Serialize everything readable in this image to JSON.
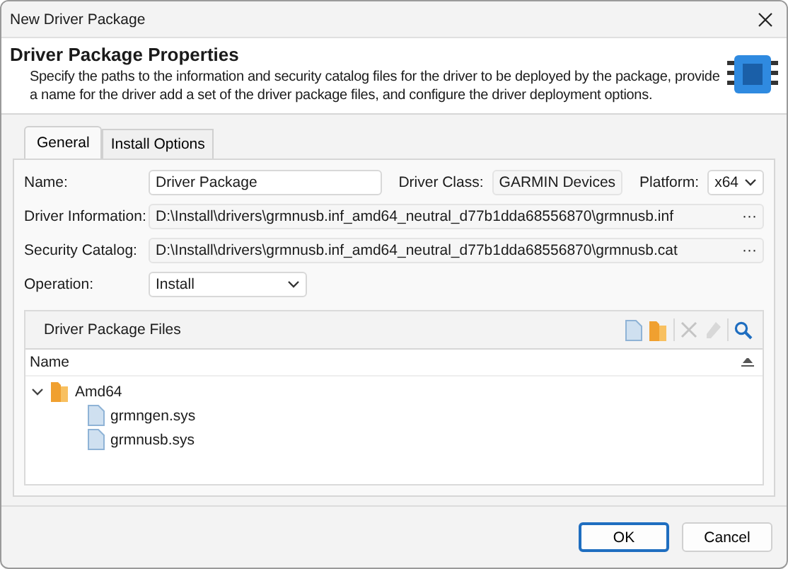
{
  "window": {
    "title": "New Driver Package"
  },
  "header": {
    "title": "Driver Package Properties",
    "description": "Specify the paths to the information and security catalog files for the driver to be deployed by the package, provide a name for the driver add a set of the driver package files, and configure the driver deployment options."
  },
  "tabs": [
    {
      "label": "General",
      "selected": true
    },
    {
      "label": "Install Options",
      "selected": false
    }
  ],
  "form": {
    "name_label": "Name:",
    "name_value": "Driver Package",
    "class_label": "Driver Class:",
    "class_value": "GARMIN Devices",
    "platform_label": "Platform:",
    "platform_value": "x64",
    "info_label": "Driver Information:",
    "info_value": "D:\\Install\\drivers\\grmnusb.inf_amd64_neutral_d77b1dda68556870\\grmnusb.inf",
    "browse_1": "···",
    "catalog_label": "Security Catalog:",
    "catalog_value": "D:\\Install\\drivers\\grmnusb.inf_amd64_neutral_d77b1dda68556870\\grmnusb.cat",
    "browse_2": "···",
    "operation_label": "Operation:",
    "operation_value": "Install"
  },
  "files": {
    "title": "Driver Package Files",
    "toolbar": [
      {
        "kind": "file",
        "disabled": false
      },
      {
        "kind": "folder",
        "disabled": false
      },
      {
        "kind": "delete",
        "disabled": true
      },
      {
        "kind": "edit",
        "disabled": true
      },
      {
        "kind": "search",
        "disabled": false
      }
    ],
    "column": "Name",
    "tree": [
      {
        "kind": "folder",
        "label": "Amd64",
        "expanded": true,
        "children": [
          {
            "kind": "file",
            "label": "grmngen.sys"
          },
          {
            "kind": "file",
            "label": "grmnusb.sys"
          }
        ]
      }
    ]
  },
  "buttons": [
    {
      "label": "OK",
      "default": true
    },
    {
      "label": "Cancel",
      "default": false
    }
  ]
}
